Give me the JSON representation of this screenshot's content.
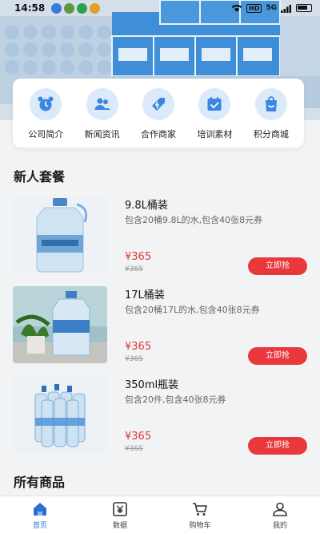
{
  "status_bar": {
    "time": "14:58",
    "hd": "HD",
    "signal": "5G"
  },
  "categories": [
    {
      "label": "公司简介",
      "icon": "alarm-clock-icon"
    },
    {
      "label": "新闻资讯",
      "icon": "people-icon"
    },
    {
      "label": "合作商家",
      "icon": "tag-icon"
    },
    {
      "label": "培训素材",
      "icon": "calendar-check-icon"
    },
    {
      "label": "积分商城",
      "icon": "shopping-bag-icon"
    }
  ],
  "sections": {
    "new_user": "新人套餐",
    "all_products": "所有商品"
  },
  "products": [
    {
      "name": "9.8L桶装",
      "desc": "包含20桶9.8L的水,包含40张8元券",
      "price": "¥365",
      "old_price": "¥365",
      "button": "立即抢"
    },
    {
      "name": "17L桶装",
      "desc": "包含20桶17L的水,包含40张8元券",
      "price": "¥365",
      "old_price": "¥365",
      "button": "立即抢"
    },
    {
      "name": "350ml瓶装",
      "desc": "包含20件,包含40张8元券",
      "price": "¥365",
      "old_price": "¥365",
      "button": "立即抢"
    }
  ],
  "tabs": [
    {
      "label": "首页",
      "icon": "home-icon",
      "active": true
    },
    {
      "label": "数据",
      "icon": "yen-icon",
      "active": false
    },
    {
      "label": "购物车",
      "icon": "cart-icon",
      "active": false
    },
    {
      "label": "我的",
      "icon": "user-icon",
      "active": false
    }
  ],
  "colors": {
    "accent": "#2b6fd6",
    "price": "#d83b3b",
    "button": "#e8383c",
    "icon_bg": "#dbeaf8",
    "icon_fg": "#3a86e0"
  }
}
